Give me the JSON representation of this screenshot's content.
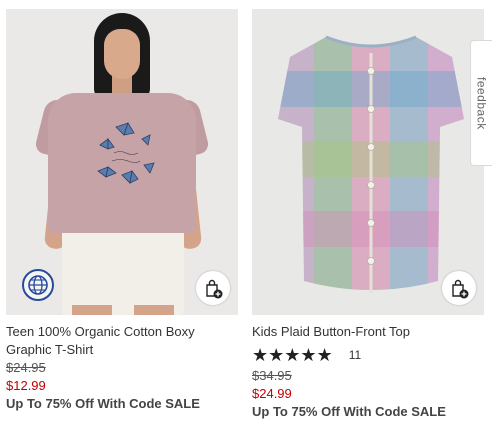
{
  "products": [
    {
      "name": "Teen 100% Organic Cotton Boxy Graphic T-Shirt",
      "old_price": "$24.95",
      "sale_price": "$12.99",
      "promo": "Up To 75% Off With Code SALE",
      "image_icon": "globe-icon",
      "bag_icon": "shopping-bag-add-icon"
    },
    {
      "name": "Kids Plaid Button-Front Top",
      "stars": "★★★★★",
      "review_count": "11",
      "old_price": "$34.95",
      "sale_price": "$24.99",
      "promo": "Up To 75% Off With Code SALE",
      "bag_icon": "shopping-bag-add-icon"
    }
  ],
  "feedback": {
    "label": "feedback"
  },
  "colors": {
    "sale": "#c30000",
    "globe_badge": "#274a9c",
    "tee": "#c6a3a6"
  }
}
